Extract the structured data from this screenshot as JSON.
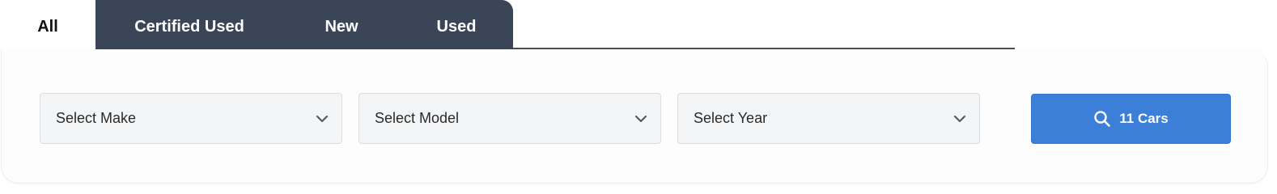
{
  "tabs": [
    {
      "label": "All",
      "active": true
    },
    {
      "label": "Certified Used",
      "active": false
    },
    {
      "label": "New",
      "active": false
    },
    {
      "label": "Used",
      "active": false
    }
  ],
  "filters": {
    "make": {
      "label": "Select Make",
      "icon": "chevron-down-icon"
    },
    "model": {
      "label": "Select Model",
      "icon": "chevron-down-icon"
    },
    "year": {
      "label": "Select Year",
      "icon": "chevron-down-icon"
    }
  },
  "search_button": {
    "label": "11 Cars",
    "icon": "search-icon"
  },
  "colors": {
    "tab_dark": "#3a4658",
    "button_accent": "#3b7fd8",
    "select_bg": "#f4f5f7"
  }
}
